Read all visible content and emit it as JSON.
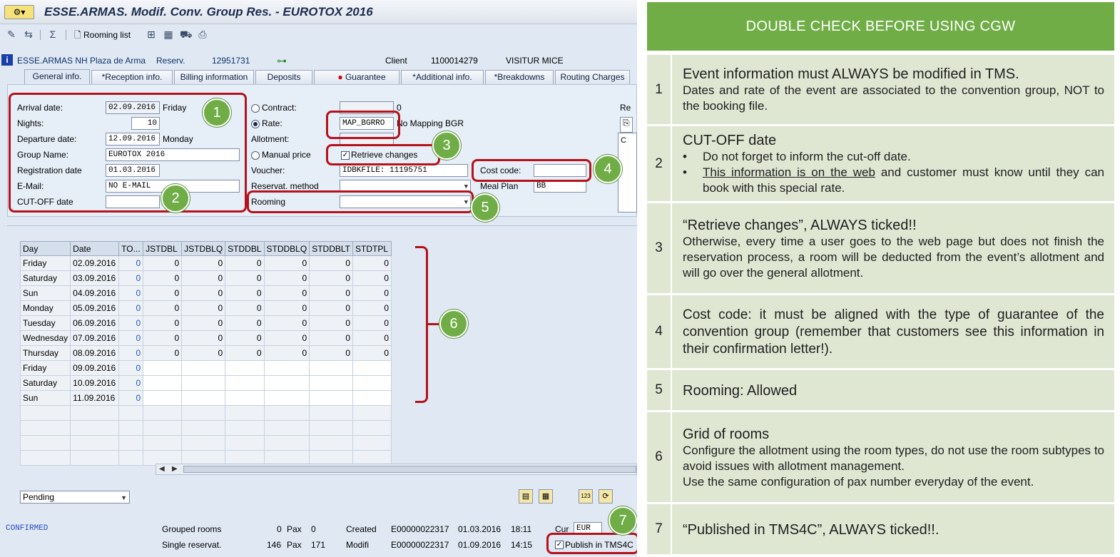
{
  "window": {
    "title": "ESSE.ARMAS. Modif. Conv. Group Res. - EUROTOX 2016",
    "rooming_list_btn": "Rooming list"
  },
  "header": {
    "hotel": "ESSE.ARMAS NH Plaza de Arma",
    "reserv_label": "Reserv.",
    "reserv_number": "12951731",
    "client_label": "Client",
    "client_number": "1100014279",
    "client_name": "VISITUR MICE"
  },
  "tabs": [
    {
      "label": "General info."
    },
    {
      "label": "*Reception info."
    },
    {
      "label": "Billing information"
    },
    {
      "label": "Deposits"
    },
    {
      "label": "Guarantee"
    },
    {
      "label": "*Additional info."
    },
    {
      "label": "*Breakdowns"
    },
    {
      "label": "Routing Charges"
    }
  ],
  "form": {
    "arrival_label": "Arrival date:",
    "arrival_value": "02.09.2016",
    "arrival_day": "Friday",
    "nights_label": "Nights:",
    "nights_value": "10",
    "departure_label": "Departure date:",
    "departure_value": "12.09.2016",
    "departure_day": "Monday",
    "group_label": "Group Name:",
    "group_value": "EUROTOX 2016",
    "registration_label": "Registration date",
    "registration_value": "01.03.2016",
    "email_label": "E-Mail:",
    "email_value": "NO E-MAIL",
    "cutoff_label": "CUT-OFF date",
    "cutoff_value": "",
    "contract_label": "Contract:",
    "contract_count": "0",
    "rate_label": "Rate:",
    "rate_value": "MAP_BGRRO",
    "rate_desc": "No Mapping BGR",
    "allotment_label": "Allotment:",
    "manual_price_label": "Manual price",
    "retrieve_label": "Retrieve changes",
    "voucher_label": "Voucher:",
    "voucher_value": "IDBKFILE: 11195751",
    "reservat_method_label": "Reservat. method",
    "rooming_label": "Rooming",
    "cost_code_label": "Cost code:",
    "cost_code_value": "",
    "meal_plan_label": "Meal Plan",
    "meal_plan_value": "BB",
    "side_label": "Re",
    "side_value": "C"
  },
  "grid": {
    "headers": [
      "Day",
      "Date",
      "TO...",
      "JSTDBL",
      "JSTDBLQ",
      "STDDBL",
      "STDDBLQ",
      "STDDBLT",
      "STDTPL"
    ],
    "rows": [
      {
        "day": "Friday",
        "date": "02.09.2016",
        "to": "0",
        "v": [
          "0",
          "0",
          "0",
          "0",
          "0",
          "0"
        ]
      },
      {
        "day": "Saturday",
        "date": "03.09.2016",
        "to": "0",
        "v": [
          "0",
          "0",
          "0",
          "0",
          "0",
          "0"
        ]
      },
      {
        "day": "Sun",
        "date": "04.09.2016",
        "to": "0",
        "v": [
          "0",
          "0",
          "0",
          "0",
          "0",
          "0"
        ]
      },
      {
        "day": "Monday",
        "date": "05.09.2016",
        "to": "0",
        "v": [
          "0",
          "0",
          "0",
          "0",
          "0",
          "0"
        ]
      },
      {
        "day": "Tuesday",
        "date": "06.09.2016",
        "to": "0",
        "v": [
          "0",
          "0",
          "0",
          "0",
          "0",
          "0"
        ]
      },
      {
        "day": "Wednesday",
        "date": "07.09.2016",
        "to": "0",
        "v": [
          "0",
          "0",
          "0",
          "0",
          "0",
          "0"
        ]
      },
      {
        "day": "Thursday",
        "date": "08.09.2016",
        "to": "0",
        "v": [
          "0",
          "0",
          "0",
          "0",
          "0",
          "0"
        ]
      },
      {
        "day": "Friday",
        "date": "09.09.2016",
        "to": "0",
        "v": [
          "",
          "",
          "",
          "",
          "",
          ""
        ]
      },
      {
        "day": "Saturday",
        "date": "10.09.2016",
        "to": "0",
        "v": [
          "",
          "",
          "",
          "",
          "",
          ""
        ]
      },
      {
        "day": "Sun",
        "date": "11.09.2016",
        "to": "0",
        "v": [
          "",
          "",
          "",
          "",
          "",
          ""
        ]
      }
    ],
    "empty_rows": 4
  },
  "bottom": {
    "status_select": "Pending",
    "confirmed": "CONFIRMED",
    "grouped_rooms_label": "Grouped rooms",
    "grouped_rooms_value": "0",
    "grouped_pax_label": "Pax",
    "grouped_pax_value": "0",
    "single_res_label": "Single reservat.",
    "single_res_value": "146",
    "single_pax_label": "Pax",
    "single_pax_value": "171",
    "created_label": "Created",
    "created_user": "E00000022317",
    "created_date": "01.03.2016",
    "created_time": "18:11",
    "modif_label": "Modifi",
    "modif_user": "E00000022317",
    "modif_date": "01.09.2016",
    "modif_time": "14:15",
    "cur_label": "Cur",
    "cur_value": "EUR",
    "publish_label": "Publish in TMS4C"
  },
  "badges": [
    "1",
    "2",
    "3",
    "4",
    "5",
    "6",
    "7"
  ],
  "info": {
    "heading": "DOUBLE CHECK BEFORE USING CGW",
    "rows": [
      {
        "num": "1",
        "title": "Event information must ALWAYS be modified in TMS.",
        "body": "Dates and rate of the event are associated to the convention group, NOT to the booking file."
      },
      {
        "num": "2",
        "title": "CUT-OFF date",
        "bullet1": "Do not forget to inform the cut-off date.",
        "bullet2_u": "This information is on the web",
        "bullet2_rest": " and customer must know until they can book with this special rate."
      },
      {
        "num": "3",
        "title": "“Retrieve changes”, ALWAYS ticked!!",
        "body": "Otherwise, every time a user goes to the web page but does not finish the reservation process, a room will be deducted from the event’s allotment and will go over the general allotment."
      },
      {
        "num": "4",
        "title_bold": "Cost code:",
        "title_rest": " it must be aligned with the type of guarantee of the convention group (remember that customers see this information in their confirmation letter!)."
      },
      {
        "num": "5",
        "title": "Rooming: Allowed"
      },
      {
        "num": "6",
        "title": "Grid of rooms",
        "body1": "Configure the allotment using the room types, do not use the room subtypes to avoid issues with allotment management.",
        "body2": "Use the same configuration of pax number everyday of the event."
      },
      {
        "num": "7",
        "title": "“Published in TMS4C”, ALWAYS ticked!!."
      }
    ]
  },
  "colors": {
    "accent_green": "#70ad47",
    "row_bg": "#dfe7d3",
    "highlight_red": "#b5121b"
  }
}
